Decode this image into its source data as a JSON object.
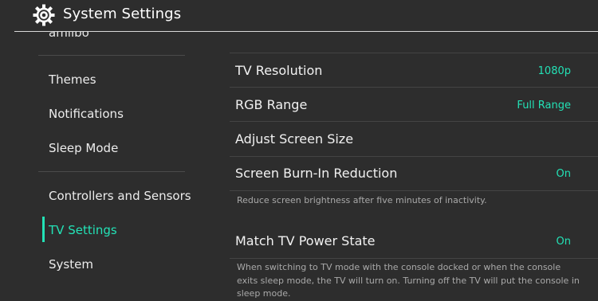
{
  "header": {
    "icon": "gear-icon",
    "title": "System Settings"
  },
  "sidebar": {
    "partial_item": "amiibo",
    "items": [
      {
        "label": "Themes",
        "active": false
      },
      {
        "label": "Notifications",
        "active": false
      },
      {
        "label": "Sleep Mode",
        "active": false
      },
      {
        "label": "Controllers and Sensors",
        "active": false
      },
      {
        "label": "TV Settings",
        "active": true
      },
      {
        "label": "System",
        "active": false
      }
    ]
  },
  "settings": [
    {
      "label": "TV Resolution",
      "value": "1080p"
    },
    {
      "label": "RGB Range",
      "value": "Full Range"
    },
    {
      "label": "Adjust Screen Size",
      "value": ""
    },
    {
      "label": "Screen Burn-In Reduction",
      "value": "On",
      "description": "Reduce screen brightness after five minutes of inactivity."
    },
    {
      "label": "Match TV Power State",
      "value": "On",
      "description": "When switching to TV mode with the console docked or when the console exits sleep mode, the TV will turn on. Turning off the TV will put the console in sleep mode."
    }
  ],
  "colors": {
    "background": "#2d2d2d",
    "accent": "#23e2b6",
    "text": "#ffffff",
    "description": "#a9a9a9"
  }
}
